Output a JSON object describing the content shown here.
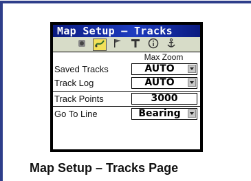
{
  "window": {
    "title": "Map Setup – Tracks"
  },
  "tabs": [
    {
      "icon": "satellite-icon",
      "active": false
    },
    {
      "icon": "track-icon",
      "active": true
    },
    {
      "icon": "flag-icon",
      "active": false
    },
    {
      "icon": "text-icon",
      "active": false
    },
    {
      "icon": "info-icon",
      "active": false
    },
    {
      "icon": "anchor-icon",
      "active": false
    }
  ],
  "column_header": "Max Zoom",
  "rows": [
    {
      "label": "Saved Tracks",
      "value": "AUTO",
      "dropdown": true
    },
    {
      "label": "Track Log",
      "value": "AUTO",
      "dropdown": true
    },
    {
      "label": "Track Points",
      "value": "3000",
      "dropdown": false
    },
    {
      "label": "Go To Line",
      "value": "Bearing",
      "dropdown": true
    }
  ],
  "caption": "Map Setup – Tracks Page"
}
